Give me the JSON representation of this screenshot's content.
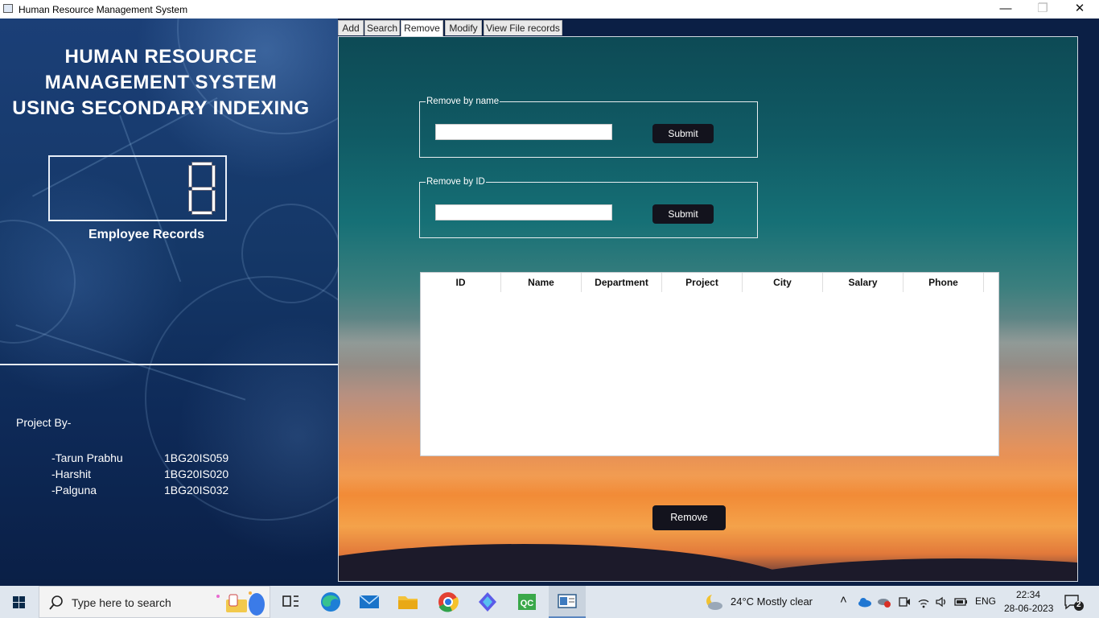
{
  "window": {
    "title": "Human Resource Management System",
    "minimize_glyph": "—",
    "maximize_glyph": "❐",
    "close_glyph": "✕"
  },
  "left_panel": {
    "heading_lines": [
      "HUMAN RESOURCE",
      "MANAGEMENT SYSTEM",
      "USING SECONDARY INDEXING"
    ],
    "record_count_display": "8",
    "record_count_label": "Employee Records",
    "project_by_label": "Project By-",
    "members": [
      {
        "name": "-Tarun Prabhu",
        "usn": "1BG20IS059"
      },
      {
        "name": "-Harshit",
        "usn": "1BG20IS020"
      },
      {
        "name": "-Palguna",
        "usn": "1BG20IS032"
      }
    ]
  },
  "tabs": [
    {
      "label": "Add",
      "active": false
    },
    {
      "label": "Search",
      "active": false
    },
    {
      "label": "Remove",
      "active": true
    },
    {
      "label": "Modify",
      "active": false
    },
    {
      "label": "View File records",
      "active": false
    }
  ],
  "remove_by_name": {
    "legend": "Remove by name",
    "value": "",
    "submit_label": "Submit"
  },
  "remove_by_id": {
    "legend": "Remove by ID",
    "value": "",
    "submit_label": "Submit"
  },
  "results_table": {
    "columns": [
      "ID",
      "Name",
      "Department",
      "Project",
      "City",
      "Salary",
      "Phone"
    ],
    "rows": []
  },
  "remove_button_label": "Remove",
  "taskbar": {
    "search_placeholder": "Type here to search",
    "weather": "24°C  Mostly clear",
    "language": "ENG",
    "time": "22:34",
    "date": "28-06-2023",
    "notification_count": "2",
    "pinned_apps": [
      "task-view",
      "edge",
      "mail",
      "file-explorer",
      "chrome",
      "copilot",
      "qt-creator",
      "hrms-app"
    ]
  },
  "colors": {
    "button_dark": "#13131d",
    "left_panel_bg": "#153868",
    "taskbar_bg": "#dfe6ee"
  }
}
